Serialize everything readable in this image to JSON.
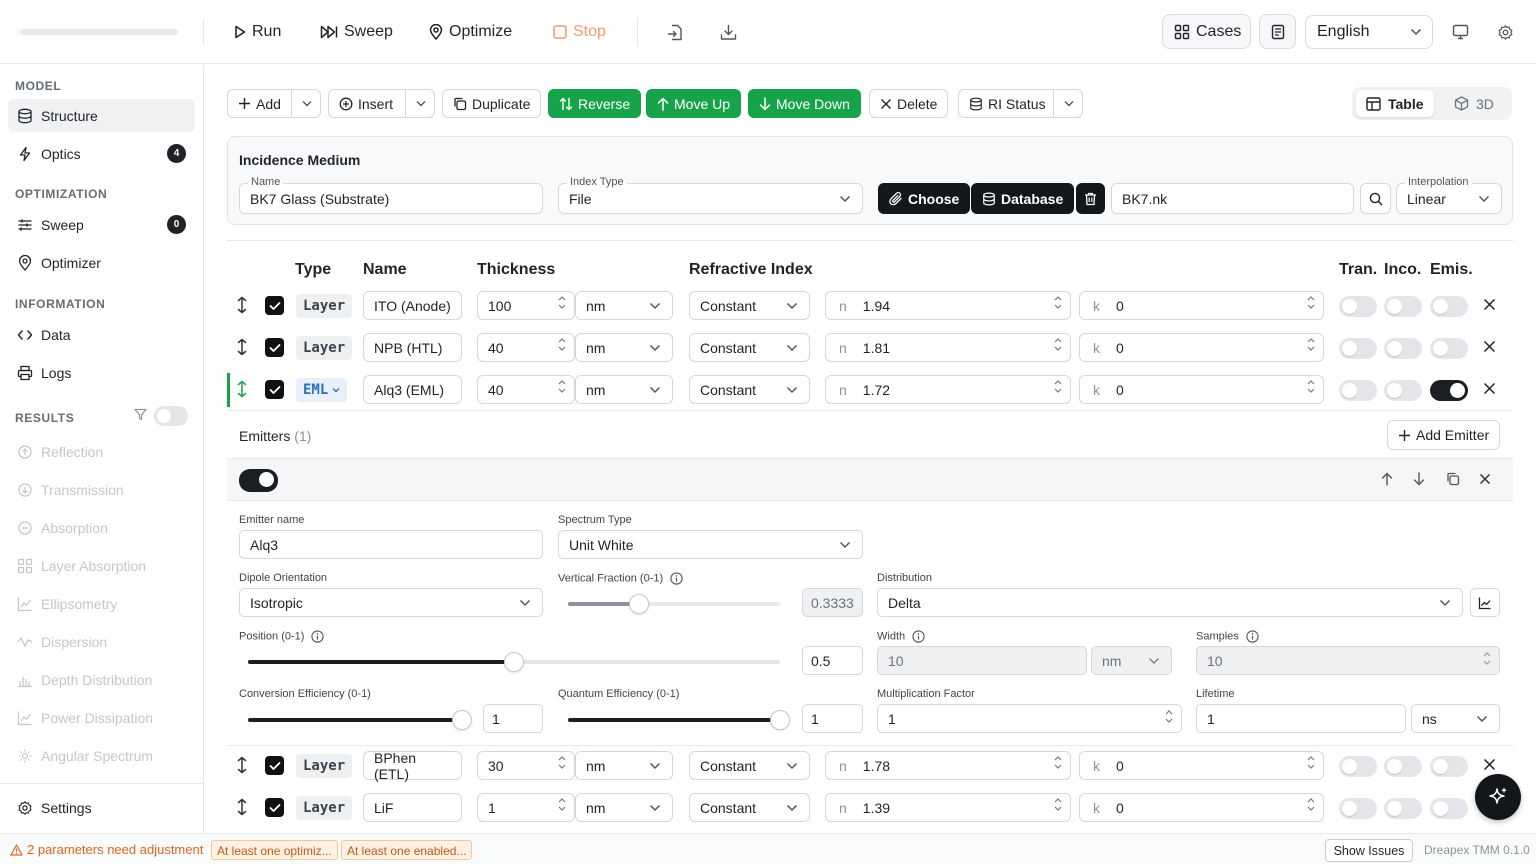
{
  "toolbar": {
    "run_label": "Run",
    "sweep_label": "Sweep",
    "optimize_label": "Optimize",
    "stop_label": "Stop",
    "cases_label": "Cases",
    "language": "English"
  },
  "sidebar": {
    "model_heading": "MODEL",
    "optimization_heading": "OPTIMIZATION",
    "information_heading": "INFORMATION",
    "results_heading": "RESULTS",
    "structure": "Structure",
    "optics": "Optics",
    "optics_badge": "4",
    "sweep": "Sweep",
    "sweep_badge": "0",
    "optimizer": "Optimizer",
    "data": "Data",
    "logs": "Logs",
    "results": [
      "Reflection",
      "Transmission",
      "Absorption",
      "Layer Absorption",
      "Ellipsometry",
      "Dispersion",
      "Depth Distribution",
      "Power Dissipation",
      "Angular Spectrum"
    ],
    "settings": "Settings"
  },
  "actions": {
    "add": "Add",
    "insert": "Insert",
    "duplicate": "Duplicate",
    "reverse": "Reverse",
    "move_up": "Move Up",
    "move_down": "Move Down",
    "delete": "Delete",
    "ri_status": "RI Status",
    "view_table": "Table",
    "view_3d": "3D"
  },
  "incidence": {
    "title": "Incidence Medium",
    "name_label": "Name",
    "name_value": "BK7 Glass (Substrate)",
    "index_type_label": "Index Type",
    "index_type_value": "File",
    "choose": "Choose",
    "database": "Database",
    "file_value": "BK7.nk",
    "interpolation_label": "Interpolation",
    "interpolation_value": "Linear"
  },
  "table": {
    "headers": {
      "type": "Type",
      "name": "Name",
      "thickness": "Thickness",
      "ri": "Refractive Index",
      "tran": "Tran.",
      "inco": "Inco.",
      "emis": "Emis."
    },
    "n_prefix": "n",
    "k_prefix": "k",
    "rows": [
      {
        "type": "Layer",
        "name": "ITO (Anode)",
        "thickness": "100",
        "unit": "nm",
        "ri_mode": "Constant",
        "n": "1.94",
        "k": "0"
      },
      {
        "type": "Layer",
        "name": "NPB (HTL)",
        "thickness": "40",
        "unit": "nm",
        "ri_mode": "Constant",
        "n": "1.81",
        "k": "0"
      },
      {
        "type": "EML",
        "name": "Alq3 (EML)",
        "thickness": "40",
        "unit": "nm",
        "ri_mode": "Constant",
        "n": "1.72",
        "k": "0"
      },
      {
        "type": "Layer",
        "name": "BPhen (ETL)",
        "thickness": "30",
        "unit": "nm",
        "ri_mode": "Constant",
        "n": "1.78",
        "k": "0"
      },
      {
        "type": "Layer",
        "name": "LiF",
        "thickness": "1",
        "unit": "nm",
        "ri_mode": "Constant",
        "n": "1.39",
        "k": "0"
      }
    ]
  },
  "emitters": {
    "title": "Emitters",
    "count": "(1)",
    "add_emitter": "Add Emitter",
    "emitter_name_label": "Emitter name",
    "emitter_name": "Alq3",
    "spectrum_type_label": "Spectrum Type",
    "spectrum_type": "Unit White",
    "dipole_label": "Dipole Orientation",
    "dipole_value": "Isotropic",
    "vertical_fraction_label": "Vertical Fraction (0-1)",
    "vertical_fraction_value": "0.3333",
    "vertical_fraction_level": 0.3333,
    "distribution_label": "Distribution",
    "distribution_value": "Delta",
    "position_label": "Position (0-1)",
    "position_value": "0.5",
    "position_level": 0.5,
    "width_label": "Width",
    "width_value": "10",
    "width_unit": "nm",
    "samples_label": "Samples",
    "samples_value": "10",
    "conversion_label": "Conversion Efficiency (0-1)",
    "conversion_value": "1",
    "conversion_level": 1,
    "quantum_label": "Quantum Efficiency (0-1)",
    "quantum_value": "1",
    "quantum_level": 1,
    "multiplication_label": "Multiplication Factor",
    "multiplication_value": "1",
    "lifetime_label": "Lifetime",
    "lifetime_value": "1",
    "lifetime_unit": "ns"
  },
  "status": {
    "warning": "2 parameters need adjustment",
    "pill1": "At least one optimiz...",
    "pill2": "At least one enabled...",
    "show_issues": "Show Issues",
    "version": "Dreapex TMM 0.1.0"
  },
  "colors": {
    "accent_green": "#16a34a",
    "dark": "#14171a",
    "warning": "#e0661f",
    "eml_blue": "#2f6fb5"
  }
}
